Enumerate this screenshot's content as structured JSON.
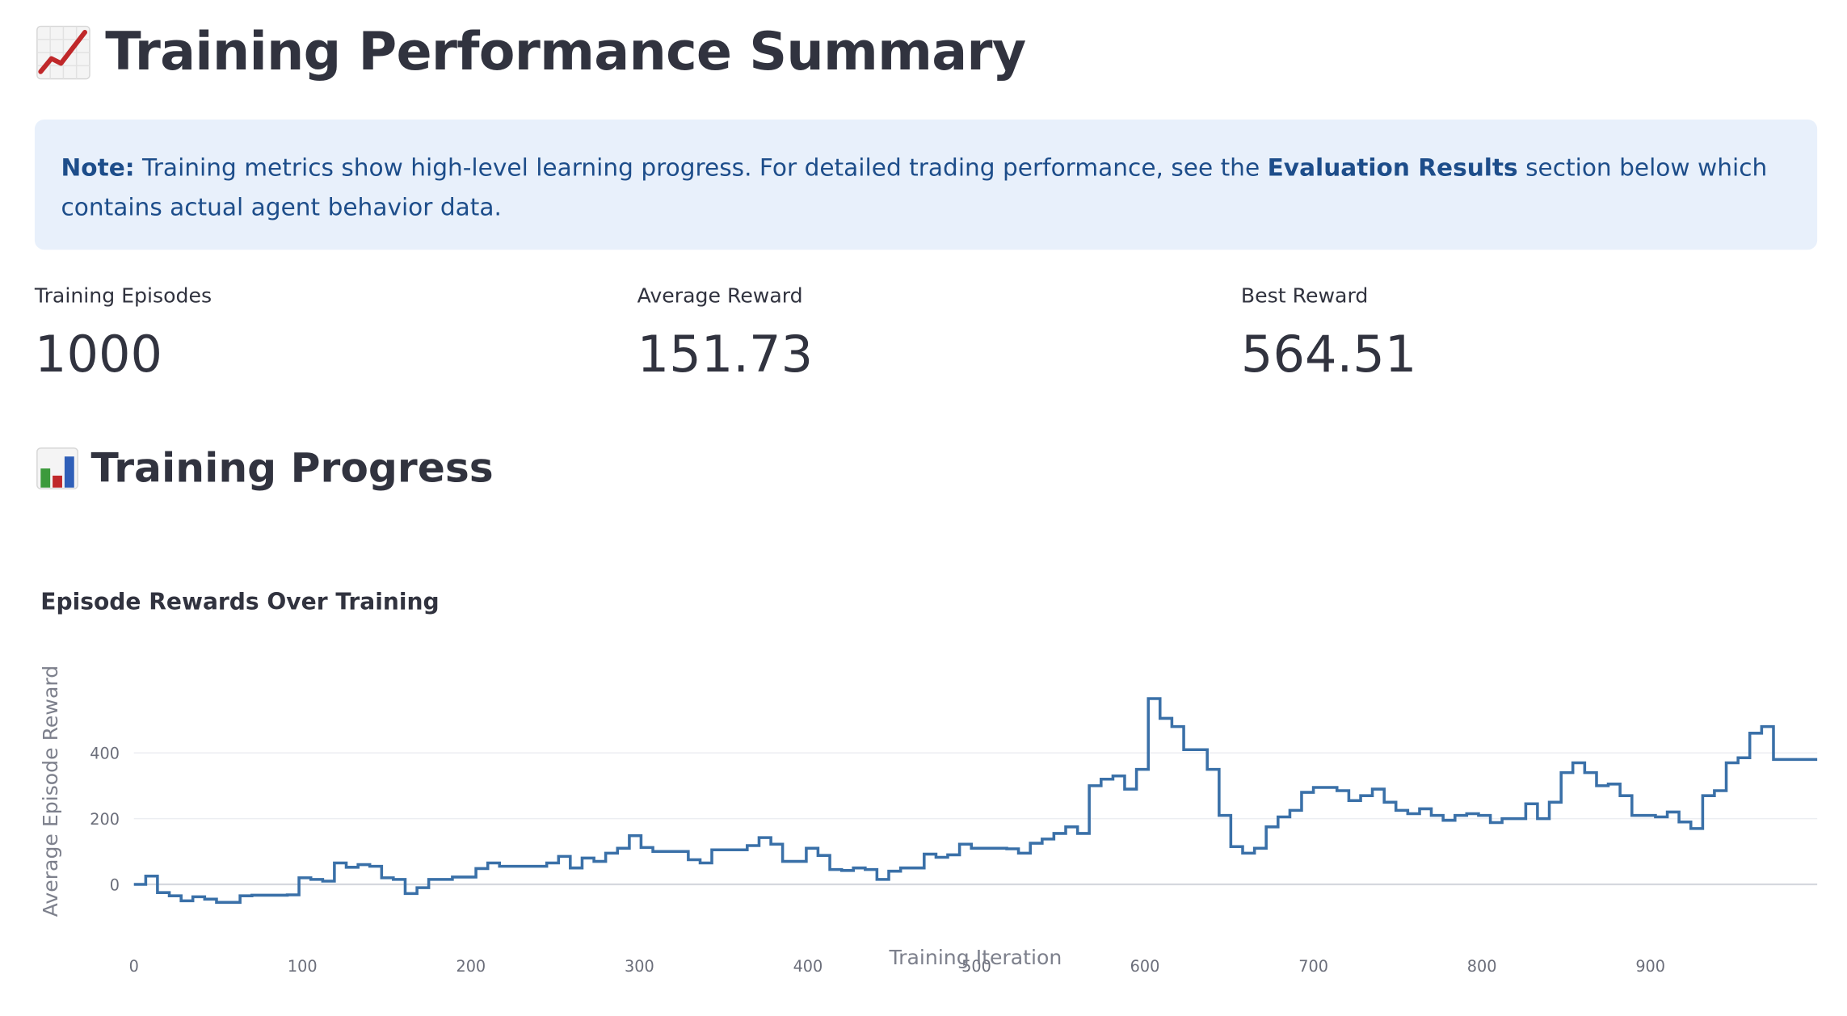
{
  "page": {
    "title": "Training Performance Summary",
    "title_icon": "chart-increasing-icon",
    "note": {
      "prefix": "Note:",
      "text_before": " Training metrics show high-level learning progress. For detailed trading performance, see the ",
      "link_text": "Evaluation Results",
      "text_after": " section below which contains actual agent behavior data."
    },
    "colors": {
      "note_background": "#e8f0fb",
      "note_text": "#1d4d8a",
      "series_line": "#3a70a8"
    }
  },
  "metrics": [
    {
      "label": "Training Episodes",
      "value": "1000"
    },
    {
      "label": "Average Reward",
      "value": "151.73"
    },
    {
      "label": "Best Reward",
      "value": "564.51"
    }
  ],
  "progress_section": {
    "title": "Training Progress",
    "title_icon": "bar-chart-icon"
  },
  "chart_data": {
    "type": "line",
    "line_shape": "step",
    "title": "Episode Rewards Over Training",
    "xlabel": "Training Iteration",
    "ylabel": "Average Episode Reward",
    "xlim": [
      0,
      999
    ],
    "ylim": [
      -80,
      600
    ],
    "x_ticks": [
      0,
      100,
      200,
      300,
      400,
      500,
      600,
      700,
      800,
      900
    ],
    "y_ticks": [
      0,
      200,
      400
    ],
    "grid": "horizontal",
    "legend": "none",
    "series": [
      {
        "points": [
          [
            0,
            0
          ],
          [
            7,
            25
          ],
          [
            14,
            -25
          ],
          [
            21,
            -35
          ],
          [
            28,
            -50
          ],
          [
            35,
            -38
          ],
          [
            42,
            -45
          ],
          [
            49,
            -55
          ],
          [
            63,
            -35
          ],
          [
            70,
            -33
          ],
          [
            91,
            -32
          ],
          [
            98,
            20
          ],
          [
            105,
            15
          ],
          [
            112,
            10
          ],
          [
            119,
            65
          ],
          [
            126,
            52
          ],
          [
            133,
            60
          ],
          [
            140,
            55
          ],
          [
            147,
            20
          ],
          [
            154,
            15
          ],
          [
            161,
            -28
          ],
          [
            168,
            -10
          ],
          [
            175,
            15
          ],
          [
            189,
            22
          ],
          [
            203,
            48
          ],
          [
            210,
            65
          ],
          [
            217,
            55
          ],
          [
            245,
            65
          ],
          [
            252,
            85
          ],
          [
            259,
            50
          ],
          [
            266,
            80
          ],
          [
            273,
            70
          ],
          [
            280,
            95
          ],
          [
            287,
            110
          ],
          [
            294,
            148
          ],
          [
            301,
            112
          ],
          [
            308,
            100
          ],
          [
            329,
            75
          ],
          [
            336,
            65
          ],
          [
            343,
            105
          ],
          [
            364,
            118
          ],
          [
            371,
            142
          ],
          [
            378,
            122
          ],
          [
            385,
            70
          ],
          [
            399,
            110
          ],
          [
            406,
            88
          ],
          [
            413,
            45
          ],
          [
            420,
            42
          ],
          [
            427,
            50
          ],
          [
            434,
            45
          ],
          [
            441,
            15
          ],
          [
            448,
            40
          ],
          [
            455,
            50
          ],
          [
            469,
            92
          ],
          [
            476,
            82
          ],
          [
            483,
            90
          ],
          [
            490,
            122
          ],
          [
            497,
            110
          ],
          [
            518,
            108
          ],
          [
            525,
            95
          ],
          [
            532,
            125
          ],
          [
            539,
            138
          ],
          [
            546,
            155
          ],
          [
            553,
            175
          ],
          [
            560,
            155
          ],
          [
            567,
            300
          ],
          [
            574,
            320
          ],
          [
            581,
            330
          ],
          [
            588,
            290
          ],
          [
            595,
            350
          ],
          [
            602,
            565
          ],
          [
            609,
            505
          ],
          [
            616,
            480
          ],
          [
            623,
            410
          ],
          [
            637,
            350
          ],
          [
            644,
            210
          ],
          [
            651,
            115
          ],
          [
            658,
            95
          ],
          [
            665,
            110
          ],
          [
            672,
            175
          ],
          [
            679,
            205
          ],
          [
            686,
            225
          ],
          [
            693,
            280
          ],
          [
            700,
            295
          ],
          [
            714,
            285
          ],
          [
            721,
            255
          ],
          [
            728,
            270
          ],
          [
            735,
            290
          ],
          [
            742,
            250
          ],
          [
            749,
            225
          ],
          [
            756,
            215
          ],
          [
            763,
            230
          ],
          [
            770,
            210
          ],
          [
            777,
            195
          ],
          [
            784,
            210
          ],
          [
            791,
            215
          ],
          [
            798,
            210
          ],
          [
            805,
            188
          ],
          [
            812,
            200
          ],
          [
            826,
            245
          ],
          [
            833,
            200
          ],
          [
            840,
            250
          ],
          [
            847,
            340
          ],
          [
            854,
            370
          ],
          [
            861,
            340
          ],
          [
            868,
            300
          ],
          [
            875,
            305
          ],
          [
            882,
            270
          ],
          [
            889,
            210
          ],
          [
            903,
            205
          ],
          [
            910,
            220
          ],
          [
            917,
            190
          ],
          [
            924,
            170
          ],
          [
            931,
            270
          ],
          [
            938,
            285
          ],
          [
            945,
            370
          ],
          [
            952,
            385
          ],
          [
            959,
            460
          ],
          [
            966,
            480
          ],
          [
            973,
            380
          ],
          [
            999,
            380
          ]
        ]
      }
    ]
  }
}
